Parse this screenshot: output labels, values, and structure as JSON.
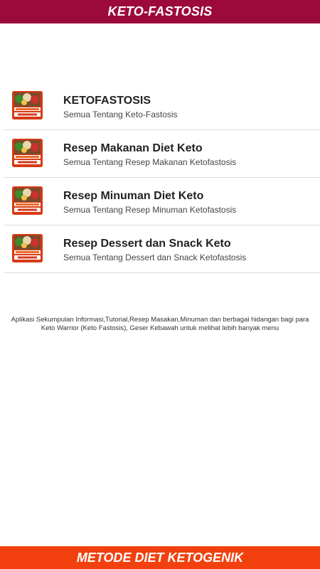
{
  "header": {
    "title": "KETO-FASTOSIS"
  },
  "menu": {
    "items": [
      {
        "title": "KETOFASTOSIS",
        "subtitle": "Semua Tentang Keto-Fastosis",
        "icon": "keto-food-thumbnail-icon"
      },
      {
        "title": "Resep Makanan Diet Keto",
        "subtitle": "Semua Tentang Resep Makanan Ketofastosis",
        "icon": "keto-food-thumbnail-icon"
      },
      {
        "title": "Resep Minuman Diet Keto",
        "subtitle": "Semua Tentang Resep Minuman Ketofastosis",
        "icon": "keto-food-thumbnail-icon"
      },
      {
        "title": "Resep Dessert dan Snack Keto",
        "subtitle": "Semua Tentang Dessert dan Snack Ketofastosis",
        "icon": "keto-food-thumbnail-icon"
      }
    ]
  },
  "info": {
    "text": "Aplikasi Sekumpulan Informasi,Tutorial,Resep Masakan,Minuman dan berbagai hidangan bagi para Keto Warrior (Keto Fastosis), Geser Kebawah untuk melihat lebih banyak menu"
  },
  "footer": {
    "title": "METODE DIET KETOGENIK"
  },
  "colors": {
    "header_bg": "#9c0a3c",
    "footer_bg": "#f2410f",
    "divider": "#dcdcdc"
  }
}
